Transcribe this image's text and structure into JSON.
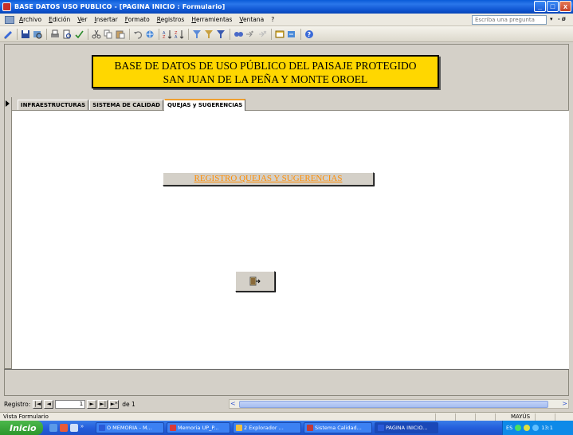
{
  "window": {
    "title": "BASE DATOS USO PUBLICO - [PAGINA INICIO : Formulario]",
    "min_glyph": "_",
    "max_glyph": "□",
    "close_glyph": "x"
  },
  "menu": {
    "items": [
      "Archivo",
      "Edición",
      "Ver",
      "Insertar",
      "Formato",
      "Registros",
      "Herramientas",
      "Ventana",
      "?"
    ],
    "help_placeholder": "Escriba una pregunta",
    "help_arrow": "▾",
    "mdi_controls": "- ø"
  },
  "toolbar": {
    "icons": [
      "design-view-icon",
      "save-icon",
      "search-icon",
      "print-icon",
      "preview-icon",
      "spelling-icon",
      "cut-icon",
      "copy-icon",
      "paste-icon",
      "undo-icon",
      "hyperlink-icon",
      "sort-asc-icon",
      "sort-desc-icon",
      "filter-selection-icon",
      "filter-form-icon",
      "apply-filter-icon",
      "find-icon",
      "new-record-icon",
      "delete-record-icon",
      "database-window-icon",
      "new-object-icon",
      "help-icon"
    ]
  },
  "header": {
    "line1": "BASE DE DATOS DE USO PÚBLICO DEL PAISAJE PROTEGIDO",
    "line2": "SAN JUAN DE LA PEÑA Y MONTE OROEL",
    "bg_color": "#ffd700"
  },
  "tabs": [
    {
      "label": "INFRAESTRUCTURAS",
      "active": false
    },
    {
      "label": "SISTEMA DE CALIDAD",
      "active": false
    },
    {
      "label": "QUEJAS y SUGERENCIAS",
      "active": true
    }
  ],
  "main": {
    "register_button_label": "REGISTRO QUEJAS Y SUGERENCIAS",
    "register_button_color": "#ff8c00",
    "exit_button_icon": "exit-door-icon"
  },
  "nav": {
    "label": "Registro:",
    "current": "1",
    "of_label": "de 1",
    "first_glyph": "|◄",
    "prev_glyph": "◄",
    "next_glyph": "►",
    "last_glyph": "►|",
    "new_glyph": "►*",
    "scroll_left_glyph": "<",
    "scroll_right_glyph": ">"
  },
  "status": {
    "left": "Vista Formulario",
    "caps": "MAYÚS"
  },
  "taskbar": {
    "start_label": "Inicio",
    "more_glyph": "»",
    "tasks": [
      {
        "label": "O MEMORIA - M...",
        "color": "#2a5ad8",
        "active": false
      },
      {
        "label": "Memoria UP_P...",
        "color": "#d83a3a",
        "active": false
      },
      {
        "label": "2 Explorador ...",
        "color": "#f0c040",
        "active": false
      },
      {
        "label": "Sistema Calidad...",
        "color": "#c03a3a",
        "active": false
      },
      {
        "label": "PAGINA INICIO...",
        "color": "#2a5ad8",
        "active": true
      }
    ],
    "tray_lang": "ES",
    "clock": "13:1"
  }
}
